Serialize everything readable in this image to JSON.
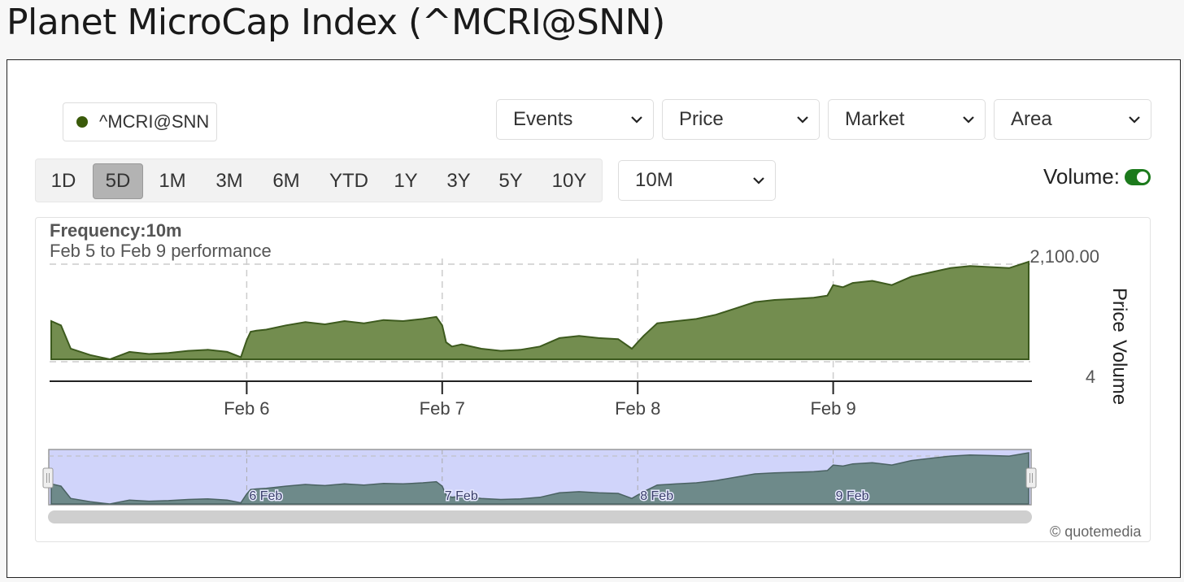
{
  "page": {
    "title": "Planet MicroCap Index (^MCRI@SNN)"
  },
  "legend": {
    "symbol": "^MCRI@SNN",
    "color": "#3a5a0a"
  },
  "dropdowns": [
    {
      "label": "Events"
    },
    {
      "label": "Price"
    },
    {
      "label": "Market"
    },
    {
      "label": "Area"
    }
  ],
  "ranges": [
    "1D",
    "5D",
    "1M",
    "3M",
    "6M",
    "YTD",
    "1Y",
    "3Y",
    "5Y",
    "10Y"
  ],
  "active_range": "5D",
  "frequency_select": "10M",
  "volume_toggle": {
    "label": "Volume:",
    "on": true,
    "color": "#1c7a1c"
  },
  "chart_header": {
    "frequency": "Frequency:10m",
    "performance": "Feb 5 to Feb 9 performance"
  },
  "credit": "© quotemedia",
  "colors": {
    "area_fill": "#738d4f",
    "area_stroke": "#3d5a1e",
    "navigator_fill": "#6e8a8a",
    "navigator_bg": "#d0d4fa"
  },
  "chart_data": {
    "type": "area",
    "title": "",
    "xlabel": "",
    "ylabels": [
      "Price",
      "Volume"
    ],
    "y_tick_labels": [
      "2,100.00"
    ],
    "volume_tick_labels": [
      "4"
    ],
    "x_tick_labels": [
      "Feb 6",
      "Feb 7",
      "Feb 8",
      "Feb 9"
    ],
    "navigator_labels": [
      "6 Feb",
      "7 Feb",
      "8 Feb",
      "9 Feb"
    ],
    "grid": true,
    "series": [
      {
        "name": "^MCRI@SNN",
        "x": [
          0,
          0.05,
          0.1,
          0.2,
          0.3,
          0.4,
          0.5,
          0.6,
          0.7,
          0.8,
          0.9,
          0.97,
          1.0,
          1.02,
          1.05,
          1.1,
          1.2,
          1.3,
          1.4,
          1.5,
          1.6,
          1.7,
          1.8,
          1.9,
          1.97,
          2.0,
          2.02,
          2.05,
          2.1,
          2.2,
          2.3,
          2.4,
          2.5,
          2.6,
          2.7,
          2.8,
          2.9,
          2.97,
          3.0,
          3.03,
          3.1,
          3.2,
          3.3,
          3.4,
          3.5,
          3.6,
          3.7,
          3.8,
          3.9,
          3.97,
          4.0,
          4.05,
          4.1,
          4.2,
          4.3,
          4.4,
          4.5,
          4.6,
          4.7,
          4.8,
          4.9,
          5.0
        ],
        "values": [
          2044,
          2040,
          2018,
          2012,
          2008,
          2015,
          2013,
          2014,
          2016,
          2017,
          2015,
          2010,
          2026,
          2034,
          2035,
          2036,
          2040,
          2043,
          2041,
          2044,
          2042,
          2045,
          2044,
          2046,
          2048,
          2040,
          2024,
          2020,
          2022,
          2018,
          2016,
          2017,
          2020,
          2028,
          2030,
          2028,
          2027,
          2018,
          2024,
          2030,
          2042,
          2044,
          2046,
          2050,
          2056,
          2062,
          2064,
          2065,
          2066,
          2068,
          2078,
          2076,
          2080,
          2082,
          2078,
          2086,
          2090,
          2094,
          2096,
          2095,
          2094,
          2100
        ]
      }
    ]
  }
}
